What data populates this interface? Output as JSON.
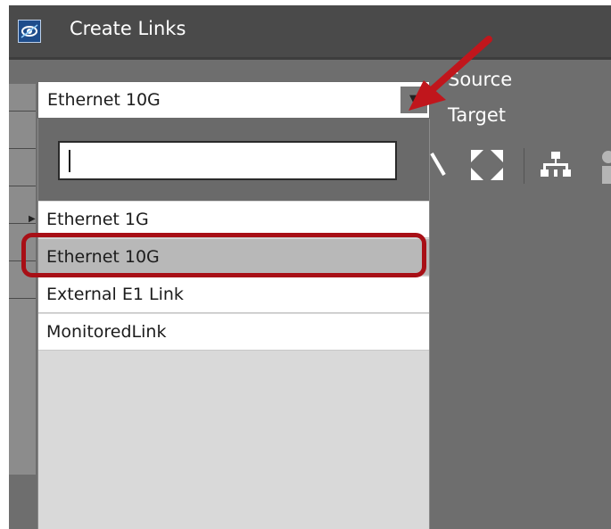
{
  "window": {
    "title": "Create Links",
    "app_icon": "eye-logo-icon"
  },
  "link_type": {
    "selected": "Ethernet 10G",
    "search_value": "",
    "options": [
      "Ethernet 1G",
      "Ethernet 10G",
      "External E1 Link",
      "MonitoredLink"
    ],
    "highlighted_index": 1
  },
  "endpoints": {
    "source_label": "Source",
    "target_label": "Target"
  },
  "toolbar": {
    "icons": [
      "search-icon",
      "fit-to-screen-icon",
      "hierarchy-layout-icon",
      "user-icon"
    ]
  },
  "colors": {
    "titlebar": "#4a4a4a",
    "panel": "#6e6e6e",
    "annotation": "#c0161c"
  }
}
